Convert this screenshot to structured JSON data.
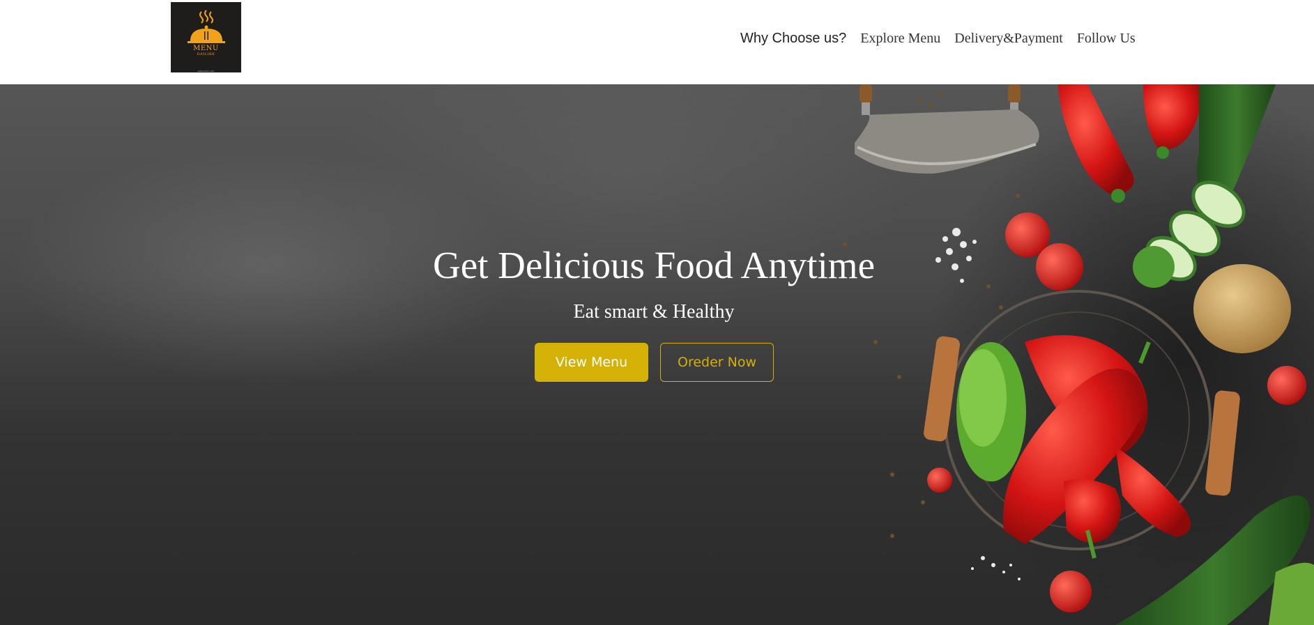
{
  "logo": {
    "name": "MENU",
    "tagline": "DAILIRE",
    "footer": "www.menu.com",
    "accent_color": "#f0a21a",
    "icon": "cloche-icon"
  },
  "nav": {
    "items": [
      {
        "label": "Why Choose us?"
      },
      {
        "label": "Explore Menu"
      },
      {
        "label": "Delivery&Payment"
      },
      {
        "label": "Follow Us"
      }
    ]
  },
  "hero": {
    "title": "Get Delicious Food Anytime",
    "subtitle": "Eat smart & Healthy",
    "view_menu_label": "View Menu",
    "order_label": "Oreder Now",
    "accent_color": "#d4b106"
  }
}
